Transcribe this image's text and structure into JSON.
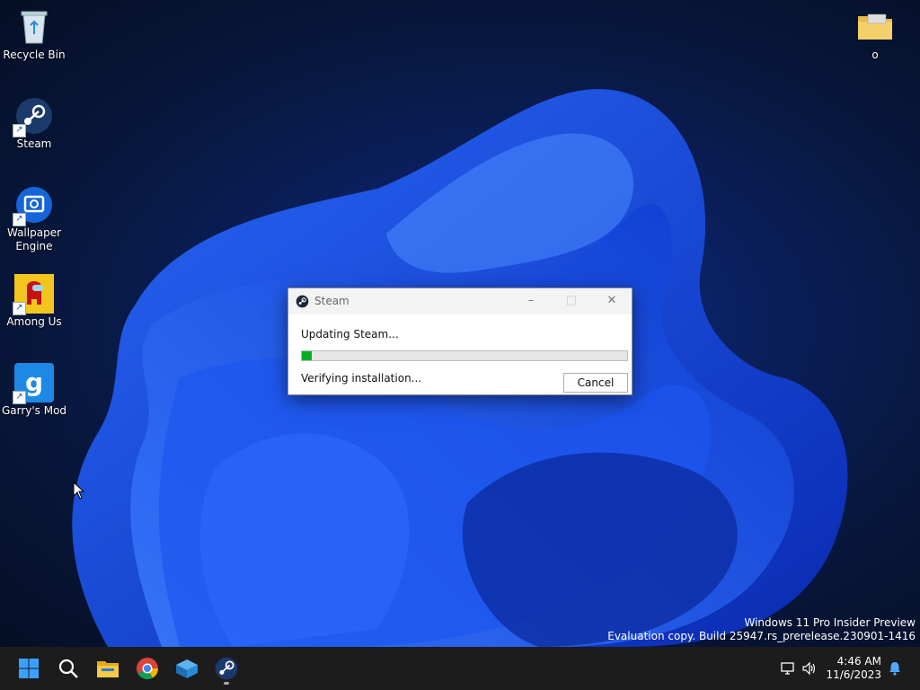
{
  "desktop": {
    "icons": [
      {
        "label": "Recycle Bin",
        "icon": "recycle-bin-icon"
      },
      {
        "label": "Steam",
        "icon": "steam-icon"
      },
      {
        "label": "Wallpaper Engine",
        "icon": "wallpaper-engine-icon"
      },
      {
        "label": "Among Us",
        "icon": "among-us-icon"
      },
      {
        "label": "Garry's Mod",
        "icon": "garrys-mod-icon"
      },
      {
        "label": "o",
        "icon": "folder-icon"
      }
    ],
    "watermark": {
      "line1": "Windows 11 Pro Insider Preview",
      "line2": "Evaluation copy. Build 25947.rs_prerelease.230901-1416"
    }
  },
  "dialog": {
    "title": "Steam",
    "status": "Updating Steam...",
    "detail": "Verifying installation...",
    "cancel_label": "Cancel",
    "progress": 0.03,
    "controls": {
      "minimize": "–",
      "maximize": "□",
      "close": "✕"
    }
  },
  "taskbar": {
    "items": [
      "start-icon",
      "search-icon",
      "file-explorer-icon",
      "chrome-icon",
      "virtualbox-icon",
      "steam-icon"
    ],
    "clock": {
      "time": "4:46 AM",
      "date": "11/6/2023"
    }
  },
  "colors": {
    "progress": "#06b025",
    "taskbar": "#1c1c1c",
    "accent": "#0078d4"
  }
}
